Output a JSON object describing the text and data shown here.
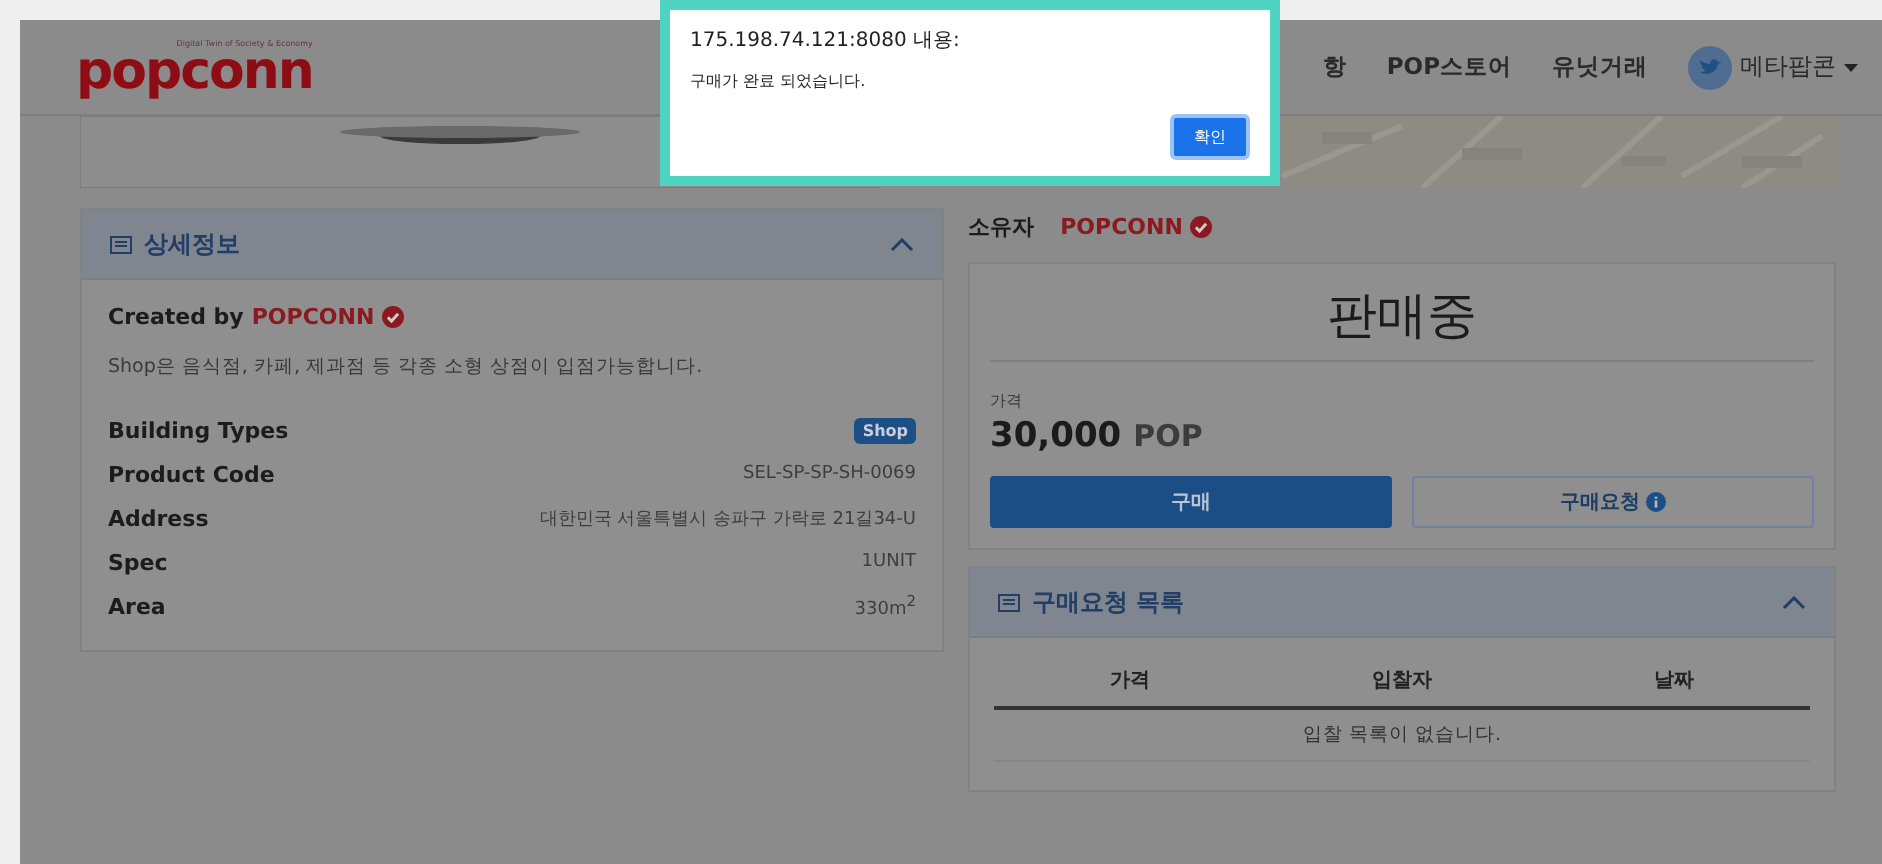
{
  "dialog": {
    "origin": "175.198.74.121:8080 내용:",
    "message": "구매가 완료 되었습니다.",
    "button": "확인"
  },
  "header": {
    "logo": "popconn",
    "tagline": "Digital Twin of Society & Economy",
    "nav": [
      "항",
      "POP스토어",
      "유닛거래"
    ],
    "user": "메타팝콘"
  },
  "detail_panel": {
    "title": "상세정보",
    "created_by": "Created by",
    "creator": "POPCONN",
    "description": "Shop은 음식점, 카페, 제과점 등 각종 소형 상점이 입점가능합니다.",
    "rows": [
      {
        "label": "Building Types",
        "value": "Shop",
        "kind": "badge"
      },
      {
        "label": "Product Code",
        "value": "SEL-SP-SP-SH-0069",
        "kind": "text"
      },
      {
        "label": "Address",
        "value": "대한민국 서울특별시 송파구 가락로 21길34-U",
        "kind": "text"
      },
      {
        "label": "Spec",
        "value": "1UNIT",
        "kind": "text"
      },
      {
        "label": "Area",
        "value": "330m$^{2}$",
        "kind": "text"
      }
    ]
  },
  "owner": {
    "label": "소유자",
    "name": "POPCONN"
  },
  "sale": {
    "status": "판매중",
    "price_label": "가격",
    "price": "30,000",
    "unit": "POP",
    "buttons": [
      {
        "label": "구매",
        "kind": "primary",
        "info": false
      },
      {
        "label": "구매요청",
        "kind": "outline",
        "info": true
      }
    ]
  },
  "requests": {
    "title": "구매요청 목록",
    "columns": [
      "가격",
      "입찰자",
      "날짜"
    ],
    "empty": "입찰 목록이 없습니다."
  }
}
